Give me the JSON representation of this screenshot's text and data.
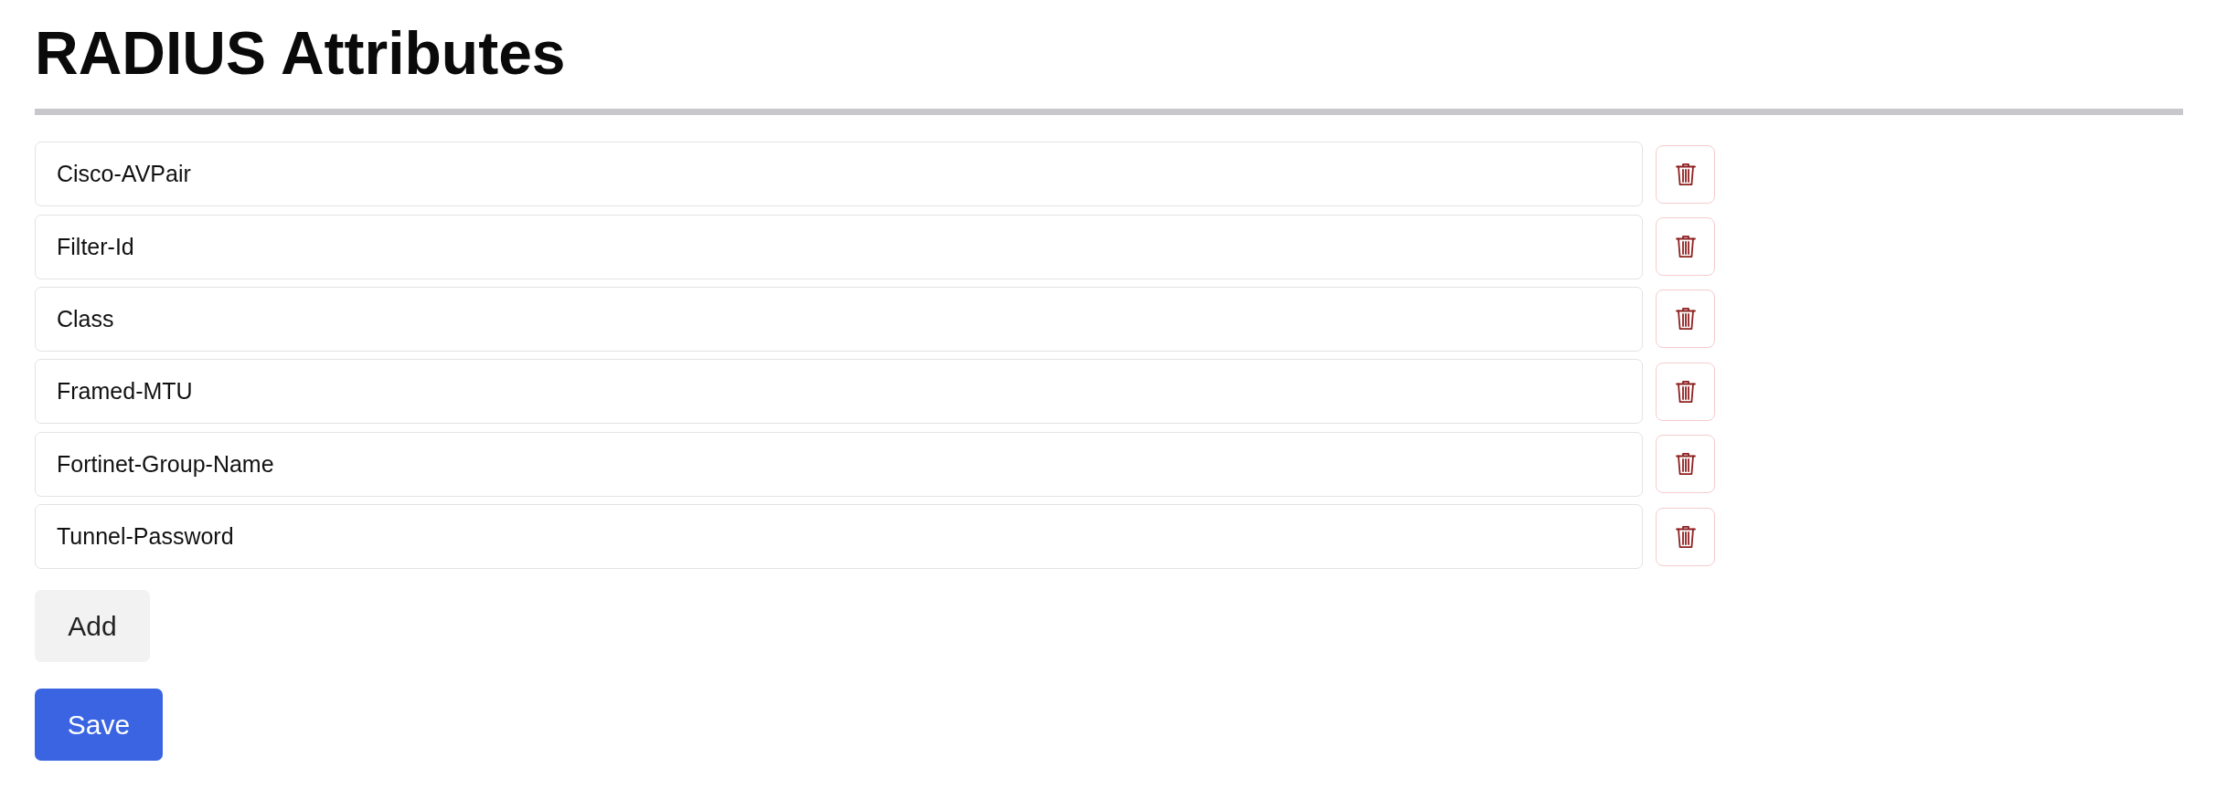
{
  "title": "RADIUS Attributes",
  "attributes": [
    {
      "value": "Cisco-AVPair"
    },
    {
      "value": "Filter-Id"
    },
    {
      "value": "Class"
    },
    {
      "value": "Framed-MTU"
    },
    {
      "value": "Fortinet-Group-Name"
    },
    {
      "value": "Tunnel-Password"
    }
  ],
  "actions": [
    {
      "kind": "secondary",
      "label": "Add"
    },
    {
      "kind": "primary",
      "label": "Save"
    }
  ]
}
